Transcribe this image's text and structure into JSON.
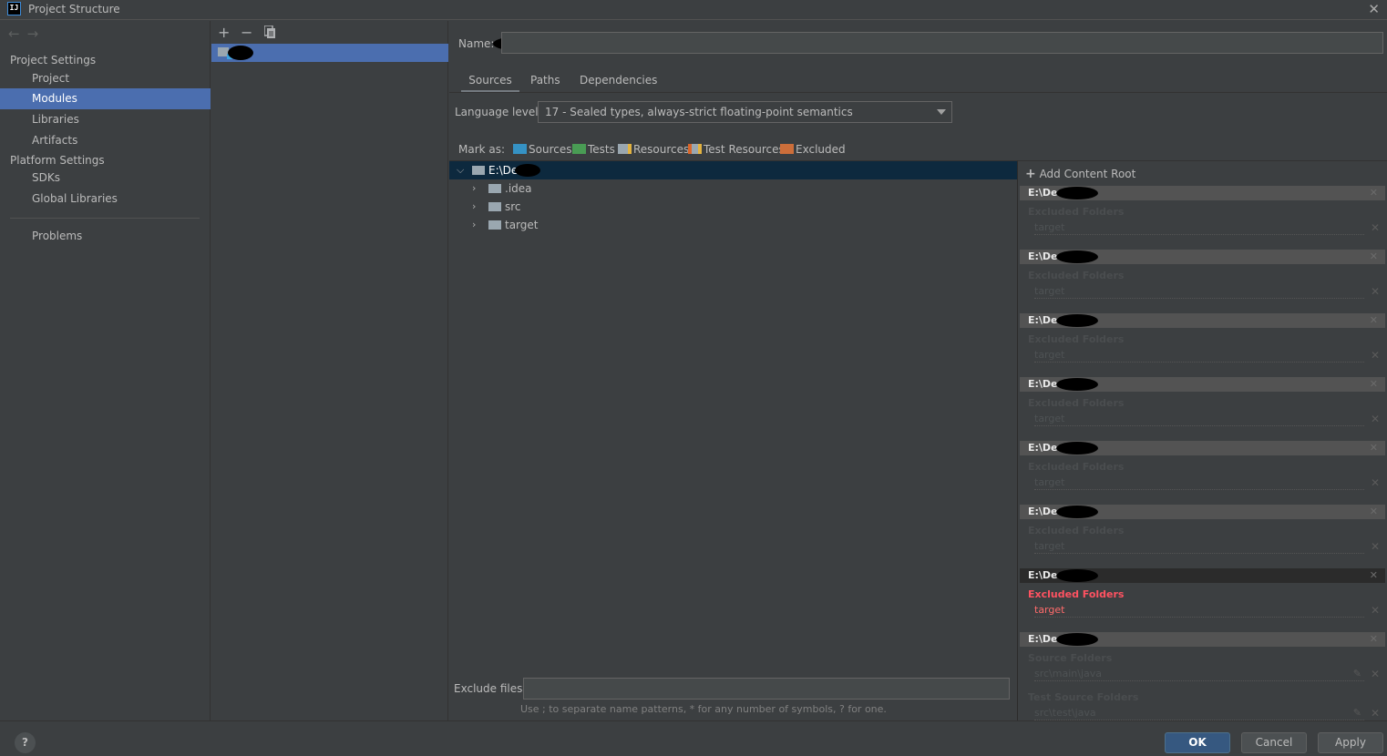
{
  "window": {
    "title": "Project Structure",
    "app_icon": "IJ"
  },
  "sidebar": {
    "sections": [
      {
        "header": "Project Settings",
        "items": [
          {
            "label": "Project",
            "selected": false
          },
          {
            "label": "Modules",
            "selected": true
          },
          {
            "label": "Libraries",
            "selected": false
          },
          {
            "label": "Artifacts",
            "selected": false
          }
        ]
      },
      {
        "header": "Platform Settings",
        "items": [
          {
            "label": "SDKs",
            "selected": false
          },
          {
            "label": "Global Libraries",
            "selected": false
          }
        ]
      }
    ],
    "problems": "Problems"
  },
  "module_list": {
    "toolbar": {
      "add": "+",
      "remove": "−",
      "copy": "copy-icon"
    },
    "selected_module": "[redacted]"
  },
  "main": {
    "name_label": "Name:",
    "name_value": "[redacted]",
    "tabs": [
      {
        "label": "Sources",
        "active": true
      },
      {
        "label": "Paths",
        "active": false
      },
      {
        "label": "Dependencies",
        "active": false
      }
    ],
    "language_level_label": "Language level:",
    "language_level_value": "17 - Sealed types, always-strict floating-point semantics",
    "mark_as_label": "Mark as:",
    "mark_as": [
      {
        "label": "Sources",
        "mnemonic": "S",
        "color": "#3592c4"
      },
      {
        "label": "Tests",
        "mnemonic": "T",
        "color": "#499c54"
      },
      {
        "label": "Resources",
        "mnemonic": "",
        "color": "#9aa7b0"
      },
      {
        "label": "Test Resources",
        "mnemonic": "",
        "color": "#9aa7b0"
      },
      {
        "label": "Excluded",
        "mnemonic": "E",
        "color": "#cc6e3a"
      }
    ],
    "tree": {
      "root": "E:\\De",
      "children": [
        ".idea",
        "src",
        "target"
      ]
    },
    "add_content_root": "Add Content Root",
    "content_roots": [
      {
        "path": "E:\\Dev",
        "sections": [
          {
            "title": "Excluded Folders",
            "entries": [
              "target"
            ]
          }
        ],
        "active": false
      },
      {
        "path": "E:\\De",
        "sections": [
          {
            "title": "Excluded Folders",
            "entries": [
              "target"
            ]
          }
        ],
        "active": false
      },
      {
        "path": "E:\\Dev",
        "sections": [
          {
            "title": "Excluded Folders",
            "entries": [
              "target"
            ]
          }
        ],
        "active": false
      },
      {
        "path": "E:\\Dev\\",
        "sections": [
          {
            "title": "Excluded Folders",
            "entries": [
              "target"
            ]
          }
        ],
        "active": false
      },
      {
        "path": "E:\\Dev",
        "sections": [
          {
            "title": "Excluded Folders",
            "entries": [
              "target"
            ]
          }
        ],
        "active": false
      },
      {
        "path": "E:\\Dev",
        "sections": [
          {
            "title": "Excluded Folders",
            "entries": [
              "target"
            ]
          }
        ],
        "active": false
      },
      {
        "path": "E:\\Dev",
        "sections": [
          {
            "title": "Excluded Folders",
            "entries": [
              "target"
            ]
          }
        ],
        "active": true
      },
      {
        "path": "E:\\Dev",
        "sections": [
          {
            "title": "Source Folders",
            "entries": [
              "src\\main\\java"
            ]
          },
          {
            "title": "Test Source Folders",
            "entries": [
              "src\\test\\java"
            ]
          }
        ],
        "active": false
      }
    ],
    "exclude_files_label": "Exclude files:",
    "exclude_files_value": "",
    "exclude_hint": "Use ; to separate name patterns, * for any number of symbols, ? for one."
  },
  "footer": {
    "help": "?",
    "ok": "OK",
    "cancel": "Cancel",
    "apply": "Apply"
  },
  "colors": {
    "selection": "#4b6eaf",
    "tree_selection": "#0d293e",
    "excluded_active": "#ff5261",
    "ok_button": "#365880"
  }
}
